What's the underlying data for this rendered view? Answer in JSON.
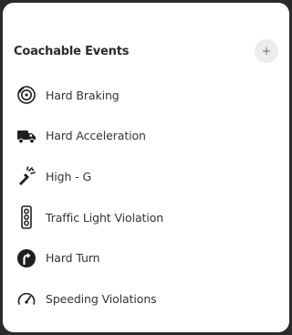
{
  "panel": {
    "title": "Coachable Events",
    "add_label": "+"
  },
  "events": [
    {
      "label": "Hard Braking",
      "icon": "hard-braking-icon"
    },
    {
      "label": "Hard Acceleration",
      "icon": "truck-icon"
    },
    {
      "label": "High - G",
      "icon": "high-g-icon"
    },
    {
      "label": "Traffic Light Violation",
      "icon": "traffic-light-icon"
    },
    {
      "label": "Hard Turn",
      "icon": "turn-arrow-icon"
    },
    {
      "label": "Speeding Violations",
      "icon": "speedometer-icon"
    }
  ]
}
